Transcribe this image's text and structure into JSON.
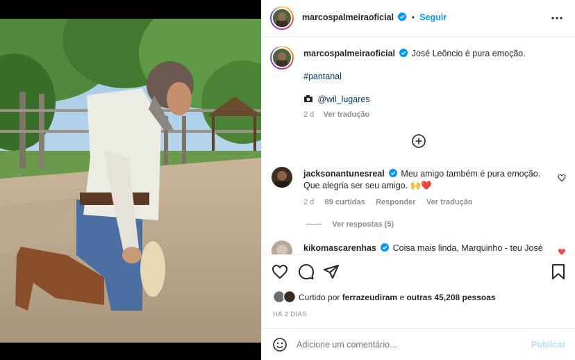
{
  "header": {
    "username": "marcospalmeiraoficial",
    "separator": "•",
    "follow_label": "Seguir",
    "more_icon": "more-horizontal-icon"
  },
  "caption": {
    "username": "marcospalmeiraoficial",
    "text": "José Leôncio é pura emoção.",
    "hashtag": "#pantanal",
    "photo_credit": "@wil_lugares",
    "time": "2 d",
    "translate_label": "Ver tradução"
  },
  "load_more_icon": "plus-circle-icon",
  "comments": [
    {
      "username": "jacksonantunesreal",
      "text_line1": "Meu amigo também é pura emoção.",
      "text_line2": "Que alegria ser seu amigo. 🙌❤️",
      "time": "2 d",
      "likes": "89 curtidas",
      "reply_label": "Responder",
      "translate_label": "Ver tradução",
      "view_replies": "Ver respostas (5)"
    },
    {
      "username": "kikomascarenhas",
      "text": "Coisa mais linda, Marquinho - teu José"
    }
  ],
  "actions": {
    "liked_prefix": "Curtido por",
    "liked_user": "ferrazeudiram",
    "liked_and": "e",
    "liked_others": "outras 45,208 pessoas",
    "time_ago": "HÁ 2 DIAS"
  },
  "comment_box": {
    "placeholder": "Adicione um comentário...",
    "publish_label": "Publicar"
  },
  "colors": {
    "accent": "#0095f6",
    "heart": "#ed4956",
    "border": "#efefef",
    "muted": "#8e8e8e"
  }
}
